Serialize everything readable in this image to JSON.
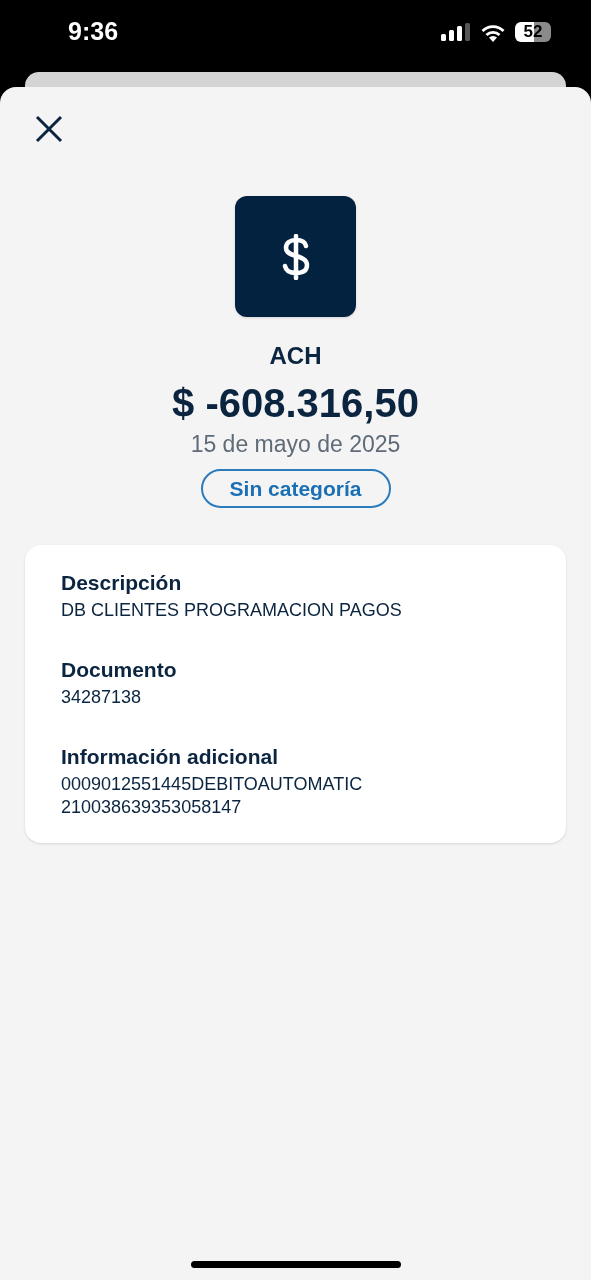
{
  "status_bar": {
    "time": "9:36",
    "battery": "52"
  },
  "transaction": {
    "type": "ACH",
    "amount": "$ -608.316,50",
    "date": "15 de mayo de 2025",
    "category": "Sin categoría"
  },
  "details": [
    {
      "label": "Descripción",
      "lines": [
        "DB CLIENTES PROGRAMACION PAGOS"
      ]
    },
    {
      "label": "Documento",
      "lines": [
        "34287138"
      ]
    },
    {
      "label": "Información adicional",
      "lines": [
        "0009012551445DEBITOAUTOMATIC",
        "210038639353058147"
      ]
    }
  ]
}
